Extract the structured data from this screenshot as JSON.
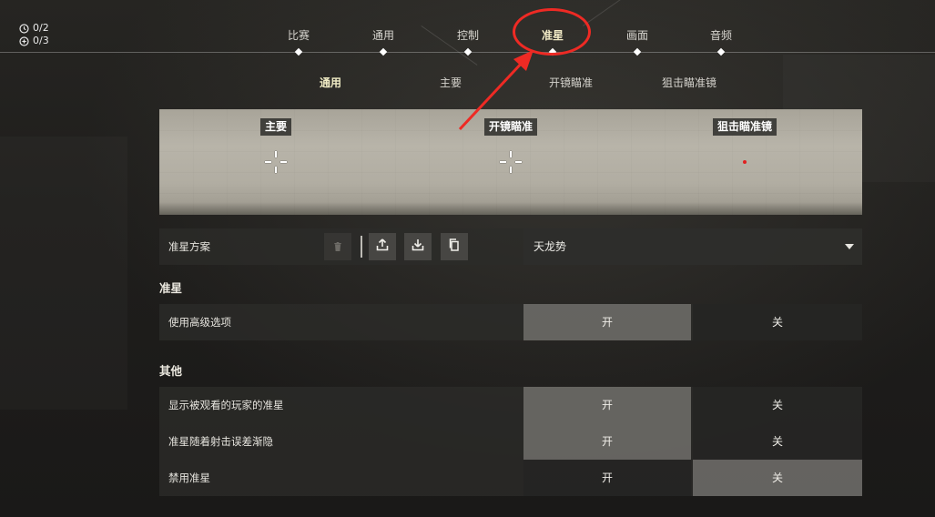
{
  "counters": [
    {
      "icon": "clock-icon",
      "text": "0/2"
    },
    {
      "icon": "star-badge-icon",
      "text": "0/3"
    }
  ],
  "nav": {
    "tabs": [
      {
        "label": "比赛"
      },
      {
        "label": "通用"
      },
      {
        "label": "控制"
      },
      {
        "label": "准星",
        "active": true
      },
      {
        "label": "画面"
      },
      {
        "label": "音频"
      }
    ]
  },
  "subnav": {
    "tabs": [
      {
        "label": "通用",
        "active": true
      },
      {
        "label": "主要"
      },
      {
        "label": "开镜瞄准"
      },
      {
        "label": "狙击瞄准镜"
      }
    ]
  },
  "preview": {
    "labels": {
      "primary": "主要",
      "ads": "开镜瞄准",
      "sniper": "狙击瞄准镜"
    },
    "crosshair_color": "#ffffff",
    "sniper_dot_color": "#e02020"
  },
  "profile": {
    "label": "准星方案",
    "actions": [
      "delete-icon",
      "upload-icon",
      "download-icon",
      "copy-icon"
    ],
    "selected": "天龙势"
  },
  "sections": [
    {
      "title": "准星",
      "rows": [
        {
          "label": "使用高级选项",
          "on": "开",
          "off": "关",
          "value": "on"
        }
      ]
    },
    {
      "title": "其他",
      "rows": [
        {
          "label": "显示被观看的玩家的准星",
          "on": "开",
          "off": "关",
          "value": "on"
        },
        {
          "label": "准星随着射击误差渐隐",
          "on": "开",
          "off": "关",
          "value": "on"
        },
        {
          "label": "禁用准星",
          "on": "开",
          "off": "关",
          "value": "off"
        }
      ]
    }
  ],
  "annotation_color": "#ee2a24"
}
